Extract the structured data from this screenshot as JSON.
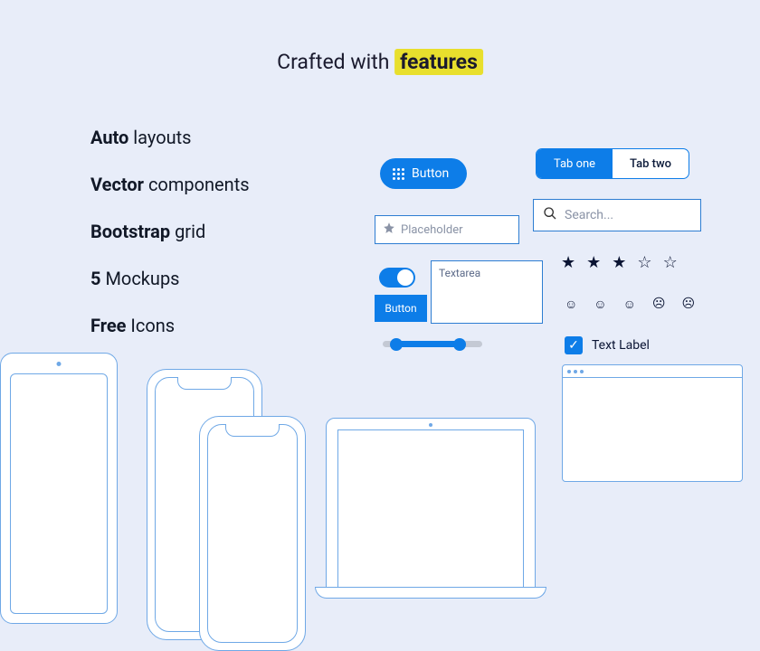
{
  "heading": {
    "prefix": "Crafted with ",
    "highlight": "features"
  },
  "features": [
    {
      "bold": "Auto",
      "rest": " layouts"
    },
    {
      "bold": "Vector",
      "rest": " components"
    },
    {
      "bold": "Bootstrap",
      "rest": " grid"
    },
    {
      "bold": "5",
      "rest": " Mockups"
    },
    {
      "bold": "Free",
      "rest": " Icons"
    }
  ],
  "pillButton": {
    "label": "Button"
  },
  "placeholderInput": {
    "placeholder": "Placeholder"
  },
  "tabs": {
    "one": "Tab one",
    "two": "Tab two"
  },
  "search": {
    "placeholder": "Search..."
  },
  "textarea": {
    "placeholder": "Textarea"
  },
  "squareButton": {
    "label": "Button"
  },
  "checkbox": {
    "label": "Text Label"
  },
  "rating": {
    "filled": 3,
    "total": 5
  },
  "emojiCount": 5
}
